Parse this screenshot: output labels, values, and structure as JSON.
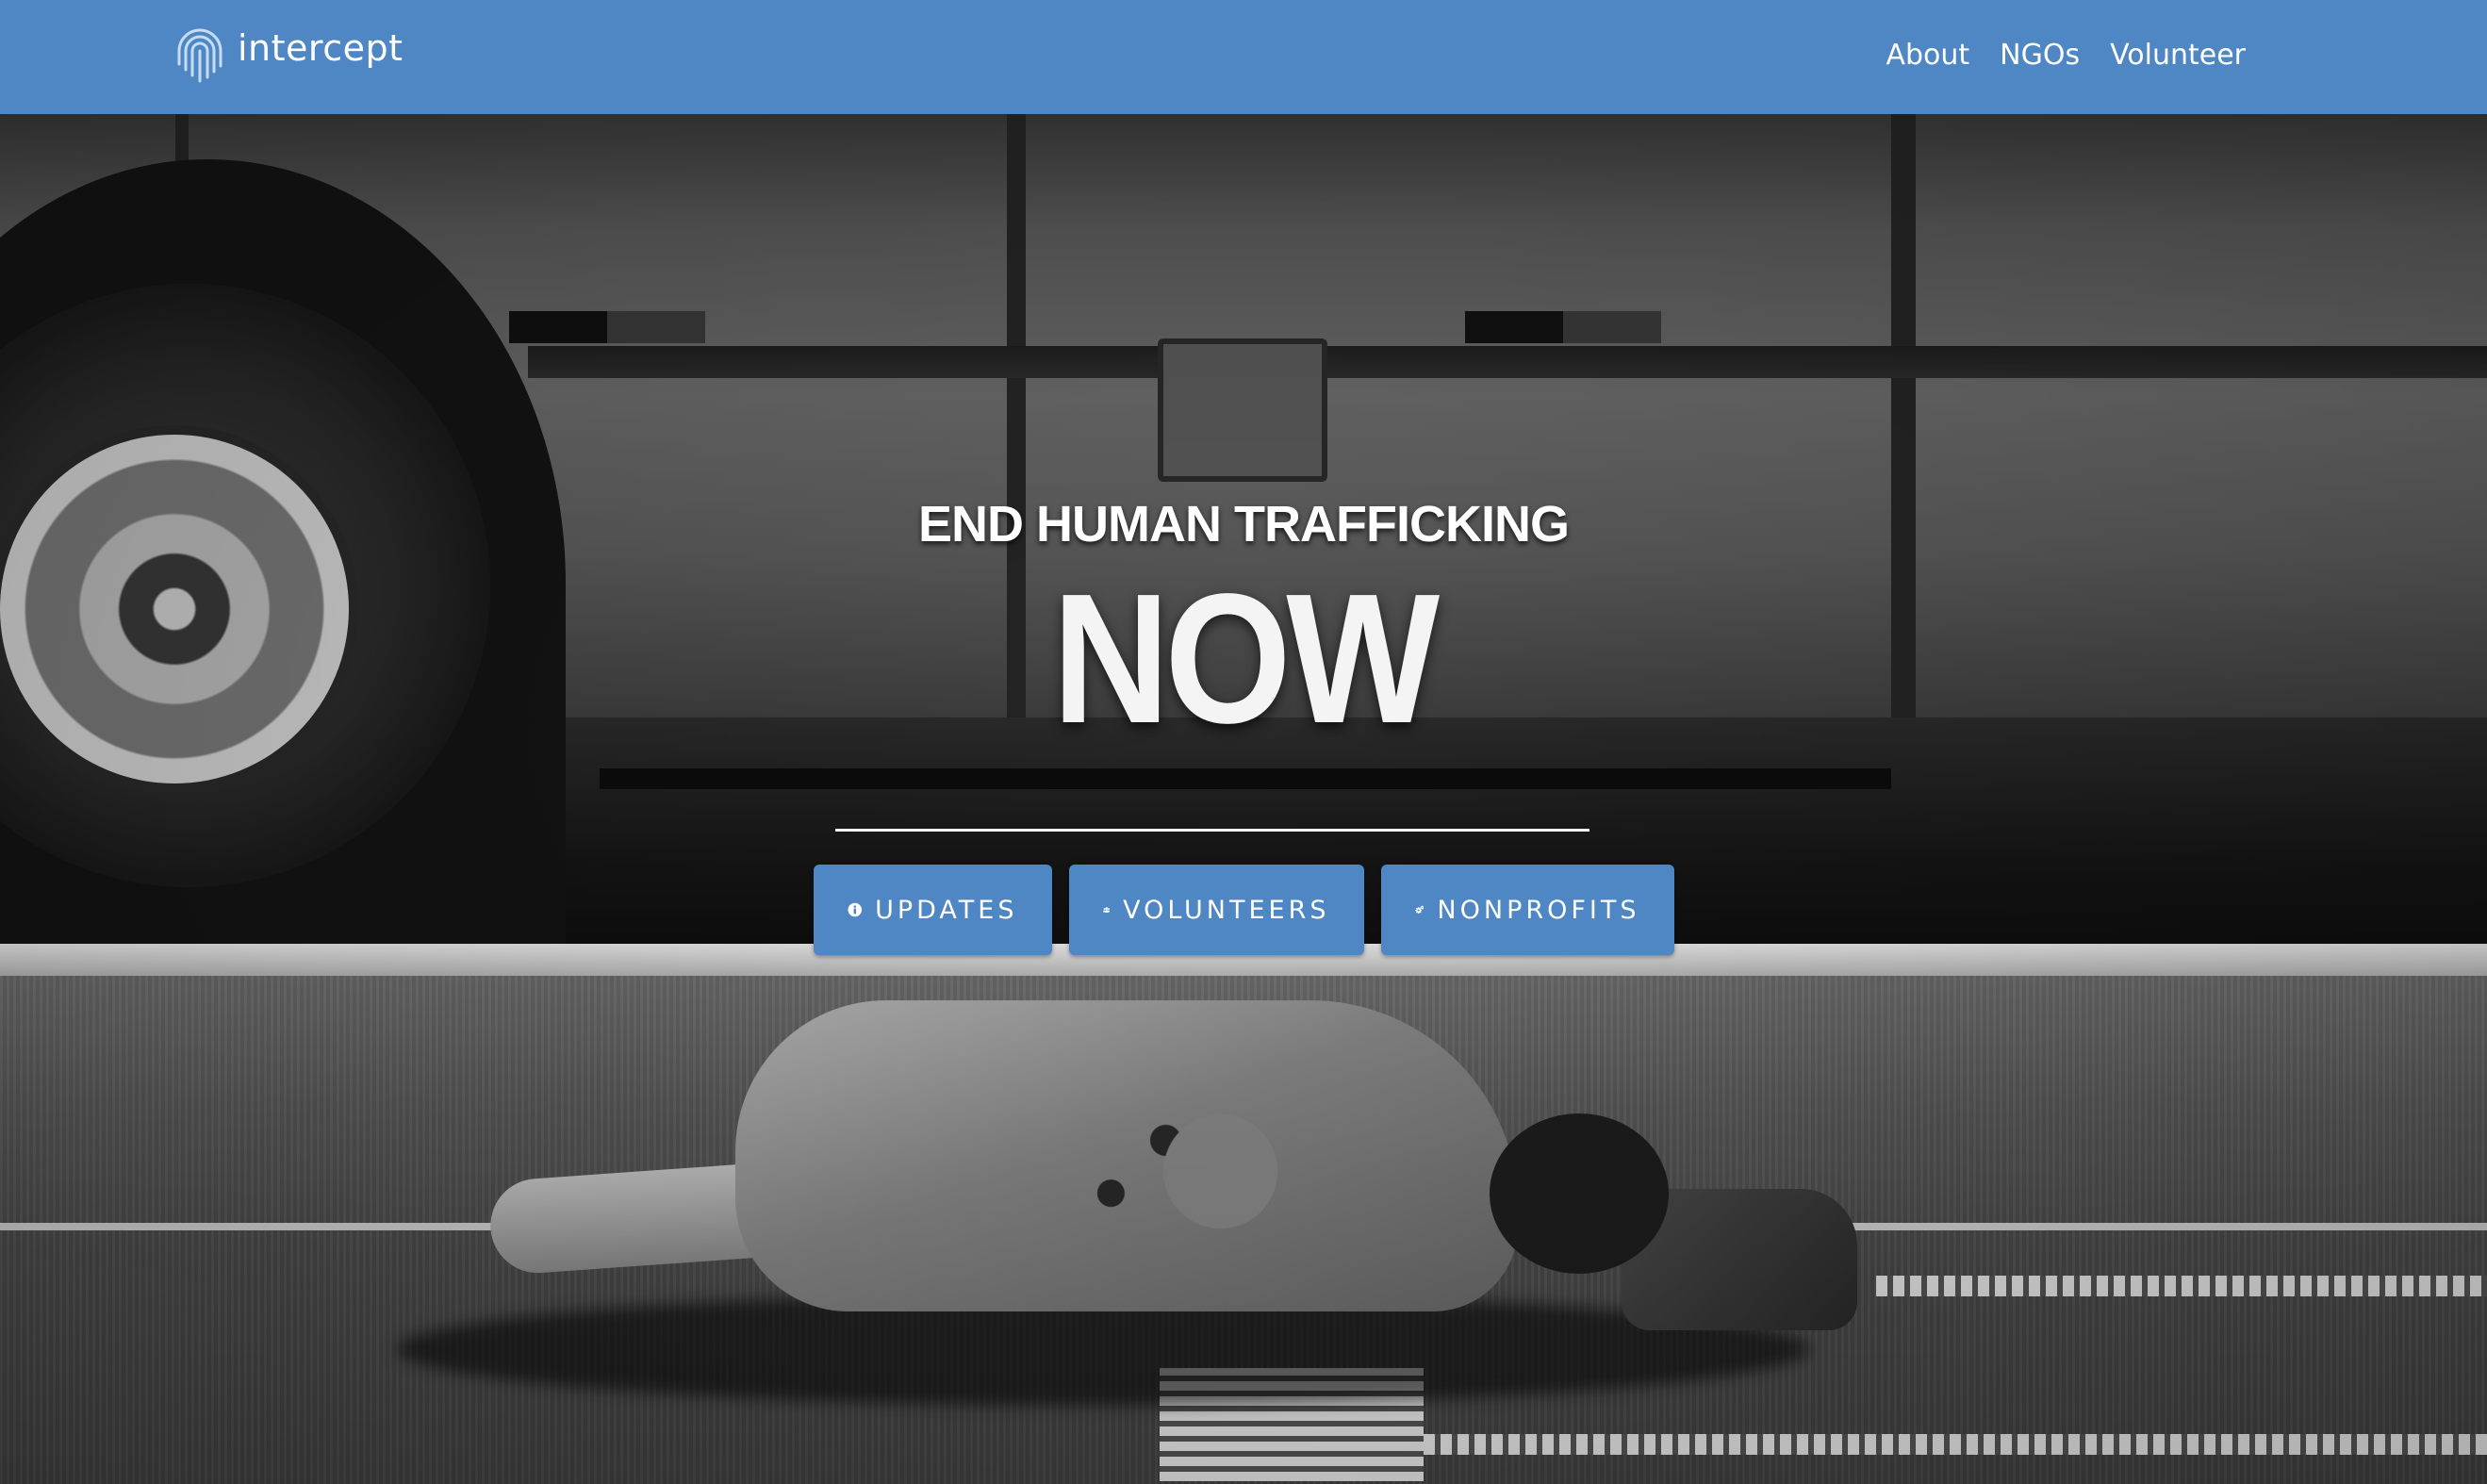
{
  "brand": {
    "name": "intercept",
    "icon": "fingerprint-icon"
  },
  "nav": {
    "items": [
      {
        "label": "About"
      },
      {
        "label": "NGOs"
      },
      {
        "label": "Volunteer"
      }
    ]
  },
  "hero": {
    "subtitle": "END HUMAN TRAFFICKING",
    "title": "NOW",
    "buttons": [
      {
        "label": "UPDATES",
        "icon": "info-circle-icon"
      },
      {
        "label": "VOLUNTEERS",
        "icon": "users-icon"
      },
      {
        "label": "NONPROFITS",
        "icon": "gears-icon"
      }
    ]
  },
  "colors": {
    "accent": "#4e87c4",
    "text_light": "#ffffff"
  }
}
